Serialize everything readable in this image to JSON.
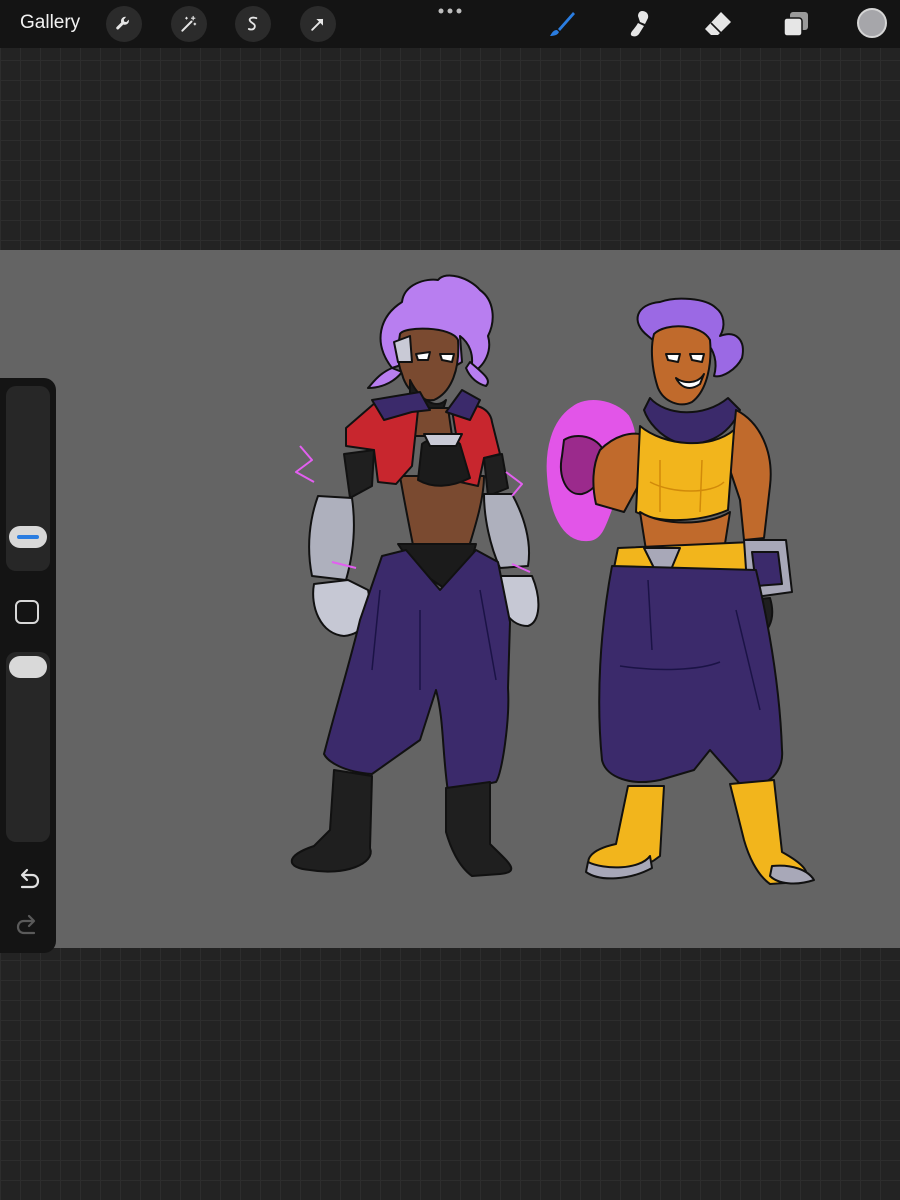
{
  "app": {
    "gallery_label": "Gallery"
  },
  "toolbar": {
    "left_tools": [
      "wrench-icon",
      "magic-wand-icon",
      "selection-icon",
      "transform-arrow-icon"
    ],
    "more_icon": "ellipsis-icon",
    "right_tools": [
      "brush-icon",
      "smudge-icon",
      "eraser-icon",
      "layers-icon"
    ],
    "active_tool": "brush",
    "active_color": "#a6a6aa",
    "accent_color": "#2a7de1"
  },
  "sidebar": {
    "size_slider_icon": "brush-size-slider",
    "opacity_slider_icon": "opacity-slider",
    "modify_icon": "square-modify-icon",
    "undo_icon": "undo-icon",
    "redo_icon": "redo-icon"
  },
  "canvas": {
    "background_color": "#646464",
    "content": "two-character-concept-art"
  }
}
